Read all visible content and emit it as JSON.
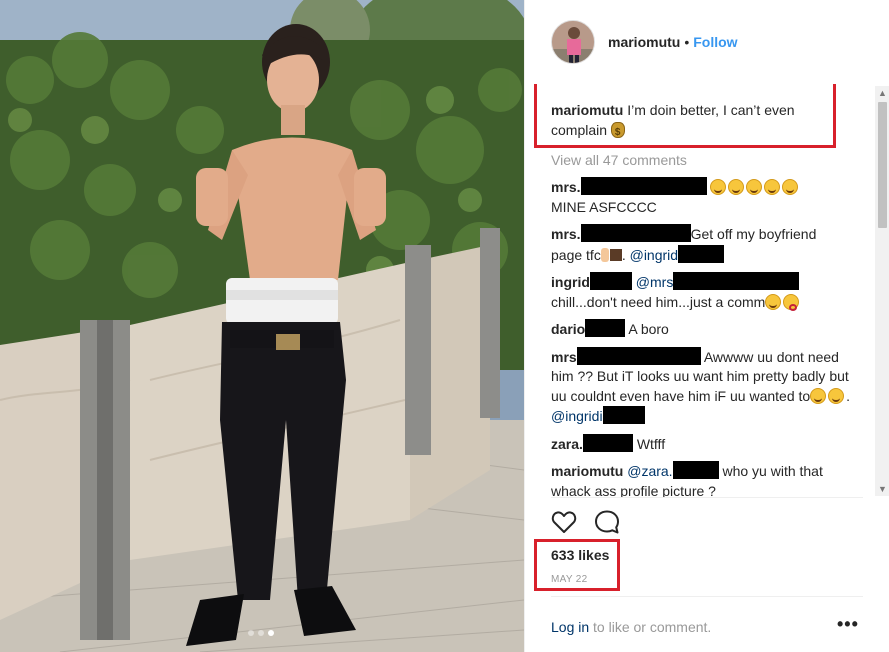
{
  "header": {
    "username": "mariomutu",
    "separator": "•",
    "follow_label": "Follow"
  },
  "caption": {
    "username": "mariomutu",
    "text": "I’m doin better, I can’t even complain"
  },
  "view_all_label": "View all 47 comments",
  "comments": [
    {
      "user": "mrs.",
      "text": "MINE ASFCCCC"
    },
    {
      "user": "mrs.",
      "text_a": "Get off my boyfriend page tfc",
      "text_b": ". ",
      "mention": "@ingrid"
    },
    {
      "user": "ingrid",
      "mention": "@mrs",
      "text": "chill...don't need him...just a comm"
    },
    {
      "user": "dario",
      "text": "A boro"
    },
    {
      "user": "mrs",
      "text": "Awwww uu dont need him ?? But iT looks uu want him pretty badly but uu couldnt even have him iF uu wanted to",
      "text_b": ". ",
      "mention": "@ingridi"
    },
    {
      "user": "zara.",
      "text": "Wtfff"
    },
    {
      "user": "mariomutu",
      "mention": "@zara.",
      "text": "who yu with that whack ass profile picture ?"
    }
  ],
  "likes_label": "633 likes",
  "date_label": "MAY 22",
  "login": {
    "link": "Log in",
    "rest": " to like or comment."
  },
  "more_label": "•••",
  "scroll": {
    "up": "▲",
    "down": "▼"
  },
  "icons": {
    "like": "heart-icon",
    "comment": "comment-bubble-icon",
    "emoji_face": "grinning-face-emoji",
    "money": "money-bag-emoji"
  },
  "colors": {
    "link_blue": "#3897f0",
    "mention": "#003569",
    "highlight_red": "#d8202b",
    "muted": "#999999"
  },
  "carousel": {
    "count": 3,
    "active_index": 2
  }
}
